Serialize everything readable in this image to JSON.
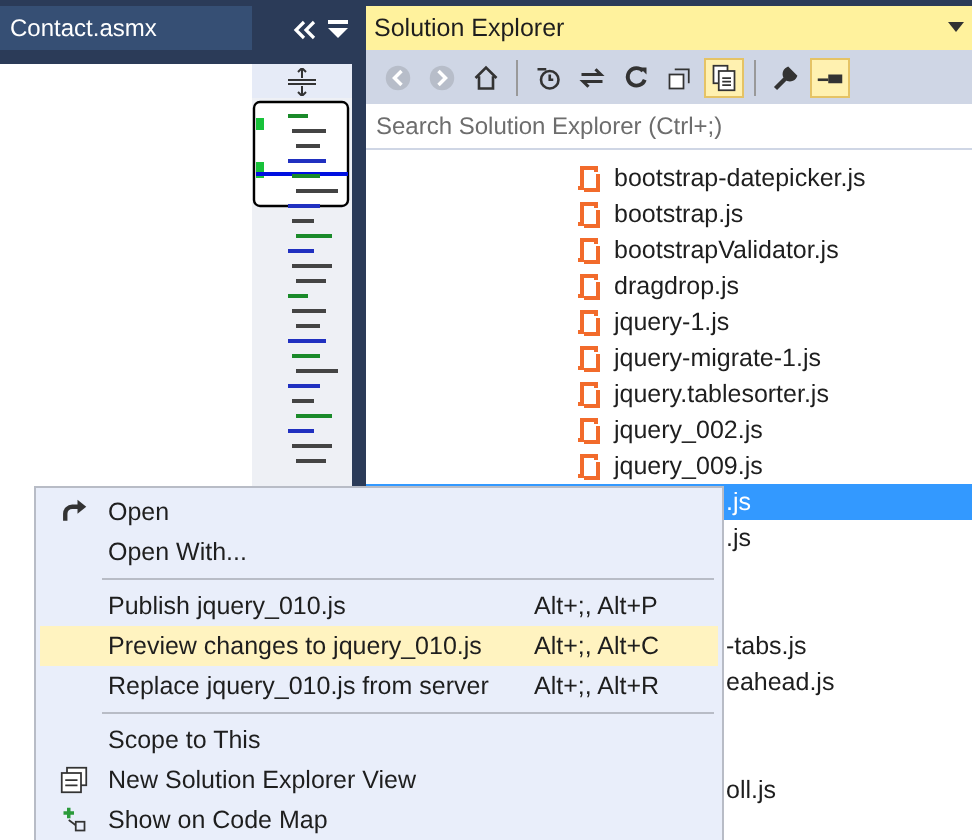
{
  "editor": {
    "tab": "Contact.asmx"
  },
  "explorer": {
    "title": "Solution Explorer",
    "search": {
      "placeholder": "Search Solution Explorer (Ctrl+;)"
    },
    "toolbar": [
      {
        "kind": "back",
        "selected": false
      },
      {
        "kind": "forward",
        "selected": false
      },
      {
        "kind": "home",
        "selected": false
      },
      {
        "kind": "sep"
      },
      {
        "kind": "history",
        "selected": false
      },
      {
        "kind": "sync",
        "selected": false
      },
      {
        "kind": "refresh",
        "selected": false
      },
      {
        "kind": "collapse",
        "selected": false
      },
      {
        "kind": "files",
        "selected": true
      },
      {
        "kind": "sep"
      },
      {
        "kind": "wrench",
        "selected": false
      },
      {
        "kind": "pin",
        "selected": true
      }
    ],
    "items": [
      {
        "label": "bootstrap-datepicker.js",
        "selected": false,
        "kind": "full"
      },
      {
        "label": "bootstrap.js",
        "selected": false,
        "kind": "full"
      },
      {
        "label": "bootstrapValidator.js",
        "selected": false,
        "kind": "full"
      },
      {
        "label": "dragdrop.js",
        "selected": false,
        "kind": "full"
      },
      {
        "label": "jquery-1.js",
        "selected": false,
        "kind": "full"
      },
      {
        "label": "jquery-migrate-1.js",
        "selected": false,
        "kind": "full"
      },
      {
        "label": "jquery.tablesorter.js",
        "selected": false,
        "kind": "full"
      },
      {
        "label": "jquery_002.js",
        "selected": false,
        "kind": "full"
      },
      {
        "label": "jquery_009.js",
        "selected": false,
        "kind": "full"
      },
      {
        "label": ".js",
        "selected": true,
        "kind": "partial"
      },
      {
        "label": ".js",
        "selected": false,
        "kind": "partial"
      },
      {
        "selected": false,
        "kind": "hidden"
      },
      {
        "selected": false,
        "kind": "hidden"
      },
      {
        "label": "-tabs.js",
        "selected": false,
        "kind": "partial"
      },
      {
        "label": "eahead.js",
        "selected": false,
        "kind": "partial"
      },
      {
        "selected": false,
        "kind": "hidden"
      },
      {
        "selected": false,
        "kind": "hidden"
      },
      {
        "label": "oll.js",
        "selected": false,
        "kind": "partial"
      }
    ]
  },
  "context_menu": [
    {
      "kind": "redo",
      "label": "Open",
      "selected": false
    },
    {
      "kind": "item",
      "label": "Open With...",
      "selected": false
    },
    {
      "kind": "sep"
    },
    {
      "kind": "item",
      "label": "Publish jquery_010.js",
      "shortcut": "Alt+;, Alt+P",
      "selected": false
    },
    {
      "kind": "item",
      "label": "Preview changes to jquery_010.js",
      "shortcut": "Alt+;, Alt+C",
      "selected": true
    },
    {
      "kind": "item",
      "label": "Replace jquery_010.js from server",
      "shortcut": "Alt+;, Alt+R",
      "selected": false
    },
    {
      "kind": "sep"
    },
    {
      "kind": "item",
      "label": "Scope to This",
      "selected": false
    },
    {
      "kind": "view",
      "label": "New Solution Explorer View",
      "selected": false
    },
    {
      "kind": "map",
      "label": "Show on Code Map",
      "selected": false
    }
  ]
}
